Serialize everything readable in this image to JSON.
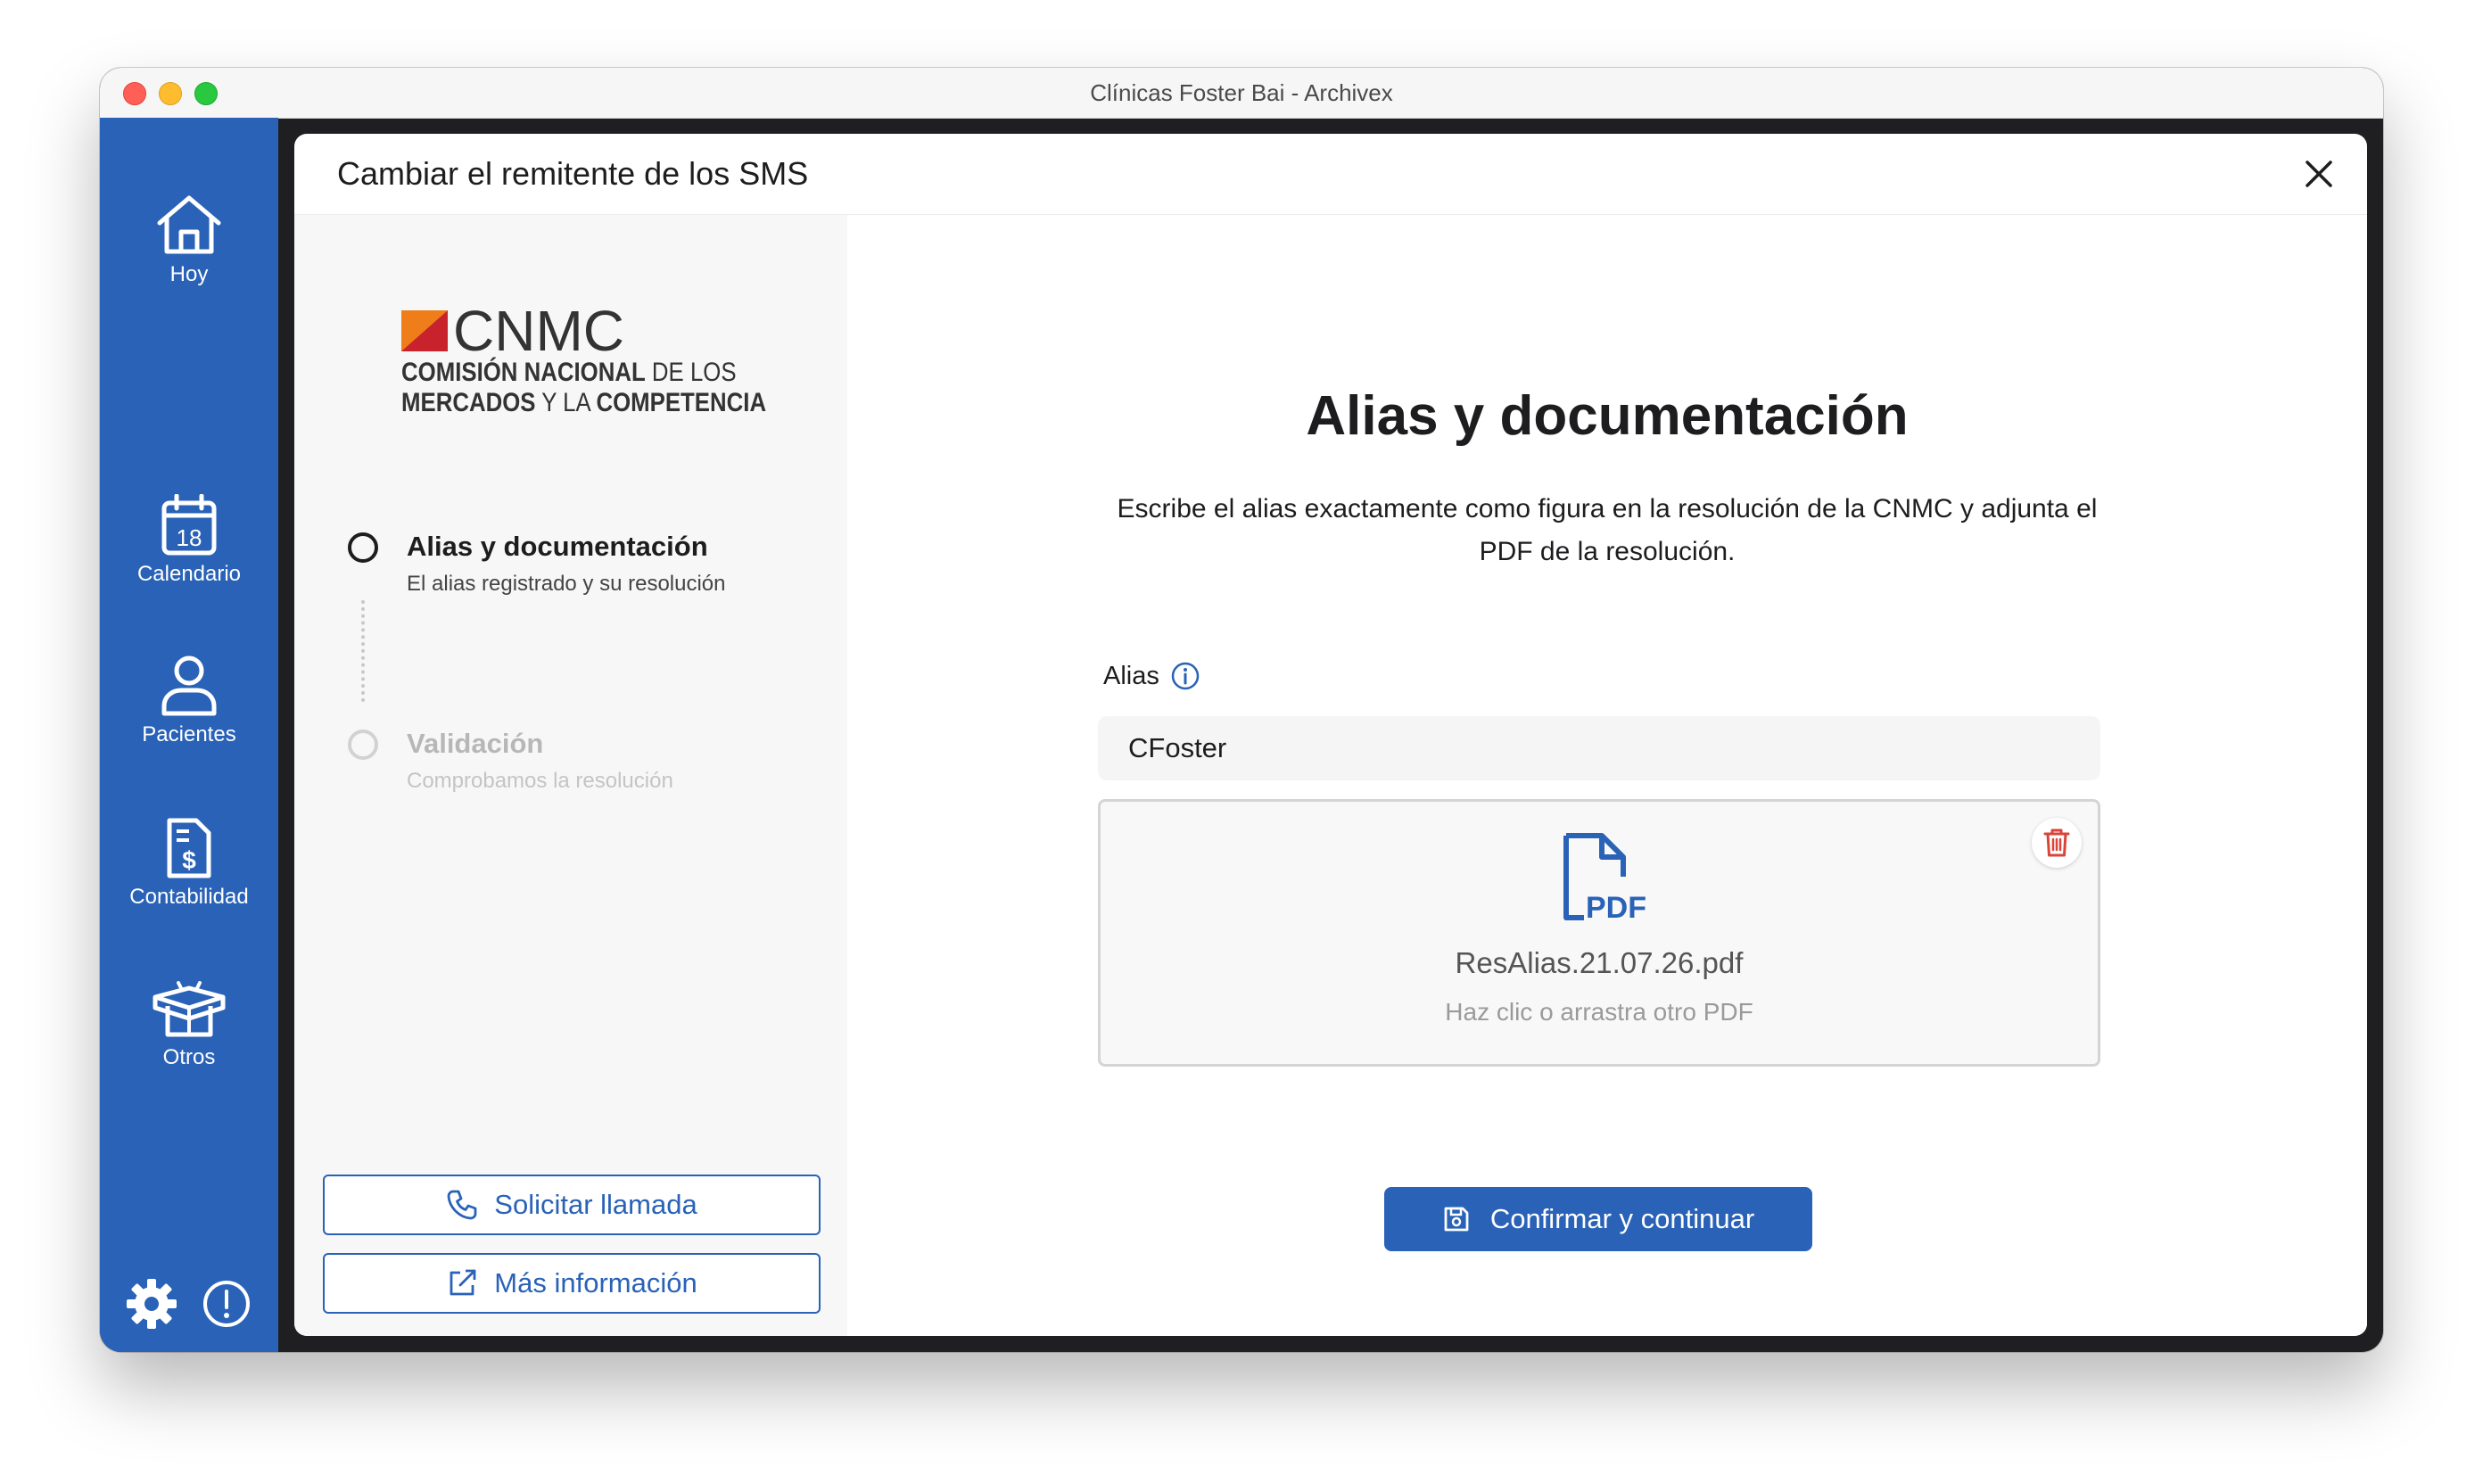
{
  "window": {
    "title": "Clínicas Foster Bai - Archivex"
  },
  "sidebar": {
    "items": [
      {
        "label": "Hoy",
        "icon": "home-icon"
      },
      {
        "label": "Calendario",
        "icon": "calendar-icon",
        "badge": "18"
      },
      {
        "label": "Pacientes",
        "icon": "user-icon"
      },
      {
        "label": "Contabilidad",
        "icon": "invoice-icon"
      },
      {
        "label": "Otros",
        "icon": "open-box-icon"
      }
    ],
    "bottom_icons": [
      "gear-icon",
      "alert-circle-icon"
    ]
  },
  "modal": {
    "title": "Cambiar el remitente de los SMS",
    "logo": {
      "word": "CNMC",
      "line1_bold": "COMISIÓN NACIONAL",
      "line1_rest": " DE LOS",
      "line2_bold": "MERCADOS",
      "line2_mid": " Y LA ",
      "line2_bold2": "COMPETENCIA"
    },
    "steps": [
      {
        "title": "Alias y documentación",
        "subtitle": "El alias registrado y su resolución",
        "state": "active"
      },
      {
        "title": "Validación",
        "subtitle": "Comprobamos la resolución",
        "state": "inactive"
      }
    ],
    "buttons": {
      "call_label": "Solicitar llamada",
      "info_label": "Más información",
      "confirm_label": "Confirmar y continuar"
    },
    "main": {
      "heading": "Alias y documentación",
      "description": "Escribe el alias exactamente como figura en la resolución de la CNMC y adjunta el PDF de la resolución.",
      "alias_label": "Alias",
      "alias_value": "CFoster",
      "file": {
        "name": "ResAlias.21.07.26.pdf",
        "hint": "Haz clic o arrastra otro PDF",
        "badge": "PDF"
      }
    }
  },
  "colors": {
    "brand_blue": "#2962b7",
    "delete_red": "#d9453a",
    "logo_orange": "#ef7d1a",
    "logo_red": "#c8232c"
  }
}
